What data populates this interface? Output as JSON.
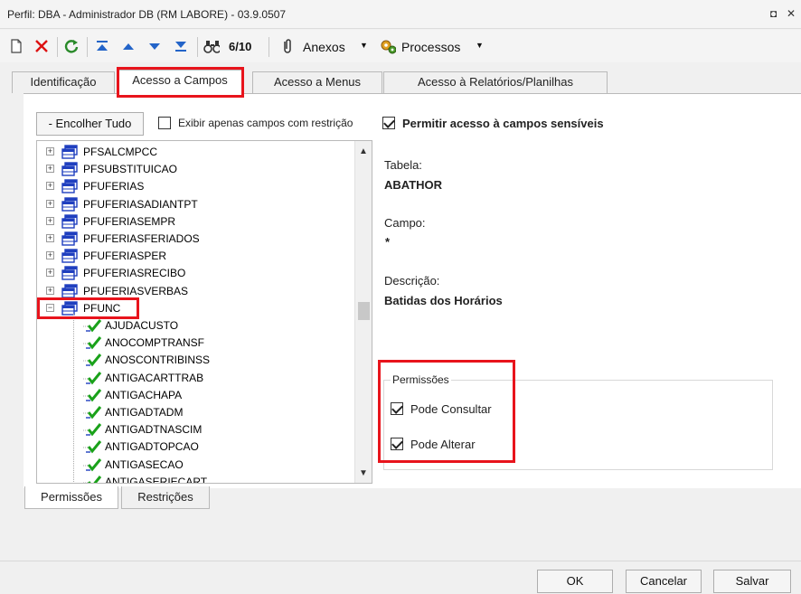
{
  "window": {
    "title": "Perfil: DBA - Administrador DB (RM LABORE) - 03.9.0507",
    "restore_glyph": "◘",
    "close_glyph": "✕"
  },
  "toolbar": {
    "record_counter": "6/10",
    "attachments_label": "Anexos",
    "processes_label": "Processos",
    "dropdown_glyph": "▼"
  },
  "tabs": [
    {
      "label": "Identificação",
      "active": false
    },
    {
      "label": "Acesso a Campos",
      "active": true
    },
    {
      "label": "Acesso a Menus",
      "active": false
    },
    {
      "label": "Acesso à Relatórios/Planilhas",
      "active": false
    }
  ],
  "controls": {
    "collapse_all_label": "- Encolher Tudo",
    "only_restricted_label": "Exibir apenas campos com restrição",
    "only_restricted_checked": false,
    "allow_sensitive_label": "Permitir acesso à campos sensíveis",
    "allow_sensitive_checked": true
  },
  "tree": {
    "tables": [
      {
        "name": "PFSALCMPCC",
        "expander": "+"
      },
      {
        "name": "PFSUBSTITUICAO",
        "expander": "+"
      },
      {
        "name": "PFUFERIAS",
        "expander": "+"
      },
      {
        "name": "PFUFERIASADIANTPT",
        "expander": "+"
      },
      {
        "name": "PFUFERIASEMPR",
        "expander": "+"
      },
      {
        "name": "PFUFERIASFERIADOS",
        "expander": "+"
      },
      {
        "name": "PFUFERIASPER",
        "expander": "+"
      },
      {
        "name": "PFUFERIASRECIBO",
        "expander": "+"
      },
      {
        "name": "PFUFERIASVERBAS",
        "expander": "+"
      },
      {
        "name": "PFUNC",
        "expander": "−"
      }
    ],
    "fields": [
      "AJUDACUSTO",
      "ANOCOMPTRANSF",
      "ANOSCONTRIBINSS",
      "ANTIGACARTTRAB",
      "ANTIGACHAPA",
      "ANTIGADTADM",
      "ANTIGADTNASCIM",
      "ANTIGADTOPCAO",
      "ANTIGASECAO",
      "ANTIGASERIECART"
    ],
    "scroll_up_glyph": "▲",
    "scroll_down_glyph": "▼"
  },
  "details": {
    "table_label": "Tabela:",
    "table_value": "ABATHOR",
    "field_label": "Campo:",
    "field_value": "*",
    "description_label": "Descrição:",
    "description_value": "Batidas dos Horários"
  },
  "permissions": {
    "group_label": "Permissões",
    "can_view_label": "Pode Consultar",
    "can_view_checked": true,
    "can_edit_label": "Pode Alterar",
    "can_edit_checked": true
  },
  "bottom_tabs": [
    {
      "label": "Permissões",
      "active": true
    },
    {
      "label": "Restrições",
      "active": false
    }
  ],
  "footer": {
    "ok_label": "OK",
    "cancel_label": "Cancelar",
    "save_label": "Salvar"
  },
  "colors": {
    "highlight_red": "#e8141c",
    "field_check_green": "#1aa11a",
    "table_icon_blue": "#1f3fbf"
  }
}
